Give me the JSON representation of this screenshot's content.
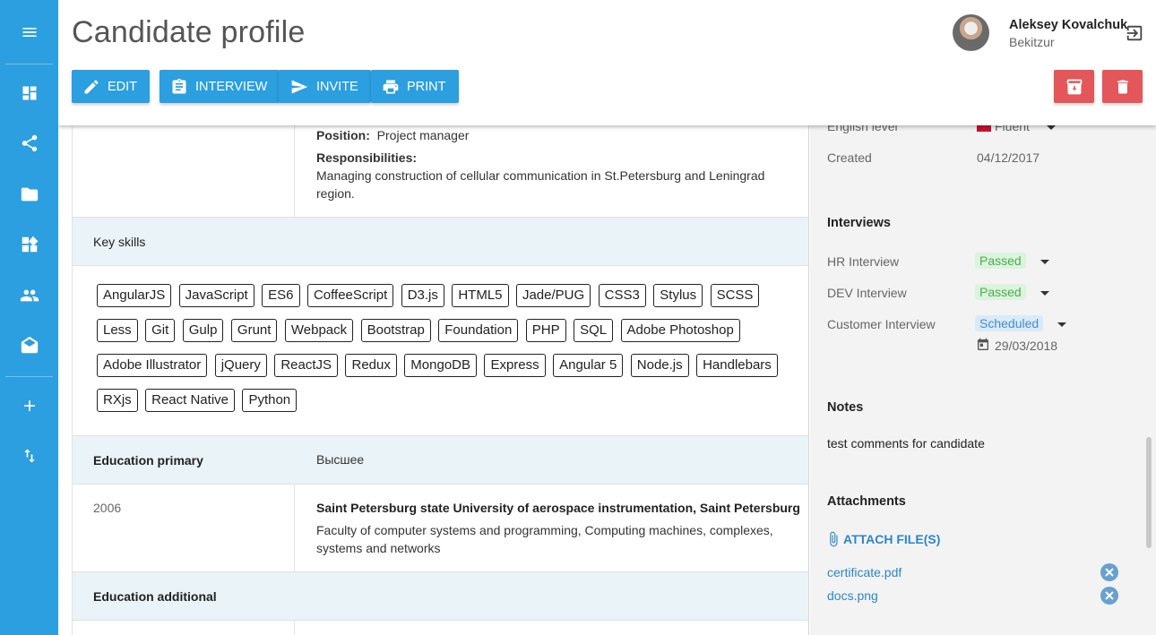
{
  "sidebar": {
    "icons": [
      "menu-icon",
      "dashboard-icon",
      "share-icon",
      "folder-icon",
      "widgets-icon",
      "people-icon",
      "drafts-icon",
      "add-icon",
      "swap-vertical-icon"
    ]
  },
  "header": {
    "title": "Candidate profile",
    "user": {
      "name": "Aleksey Kovalchuk",
      "company": "Bekitzur"
    },
    "buttons": {
      "edit": "EDIT",
      "interview": "INTERVIEW",
      "invite": "INVITE",
      "print": "PRINT"
    },
    "accent_color": "#2b9fdf",
    "danger_color": "#e3565a"
  },
  "experience": {
    "position_label": "Position:",
    "position_value": "Project manager",
    "responsibilities_label": "Responsibilities:",
    "responsibilities_text": "Managing construction of cellular communication in St.Petersburg and Leningrad region."
  },
  "skills": {
    "label": "Key skills",
    "items": [
      "AngularJS",
      "JavaScript",
      "ES6",
      "CoffeeScript",
      "D3.js",
      "HTML5",
      "Jade/PUG",
      "CSS3",
      "Stylus",
      "SCSS",
      "Less",
      "Git",
      "Gulp",
      "Grunt",
      "Webpack",
      "Bootstrap",
      "Foundation",
      "PHP",
      "SQL",
      "Adobe Photoshop",
      "Adobe Illustrator",
      "jQuery",
      "ReactJS",
      "Redux",
      "MongoDB",
      "Express",
      "Angular 5",
      "Node.js",
      "Handlebars",
      "RXjs",
      "React Native",
      "Python"
    ]
  },
  "education": {
    "primary_label": "Education primary",
    "primary_value": "Высшее",
    "year": "2006",
    "school": "Saint Petersburg state University of aerospace instrumentation, Saint Petersburg",
    "details": "Faculty of computer systems and programming, Computing machines, complexes, systems and networks",
    "additional_label": "Education additional"
  },
  "side": {
    "english_label": "English level",
    "english_value": "Fluent",
    "created_label": "Created",
    "created_value": "04/12/2017",
    "interviews_heading": "Interviews",
    "interviews": [
      {
        "name": "HR Interview",
        "status": "Passed"
      },
      {
        "name": "DEV Interview",
        "status": "Passed"
      },
      {
        "name": "Customer Interview",
        "status": "Scheduled",
        "date": "29/03/2018"
      }
    ],
    "notes_heading": "Notes",
    "notes_text": "test comments for candidate",
    "attachments_heading": "Attachments",
    "attach_label": "ATTACH FILE(S)",
    "files": [
      "certificate.pdf",
      "docs.png"
    ]
  }
}
